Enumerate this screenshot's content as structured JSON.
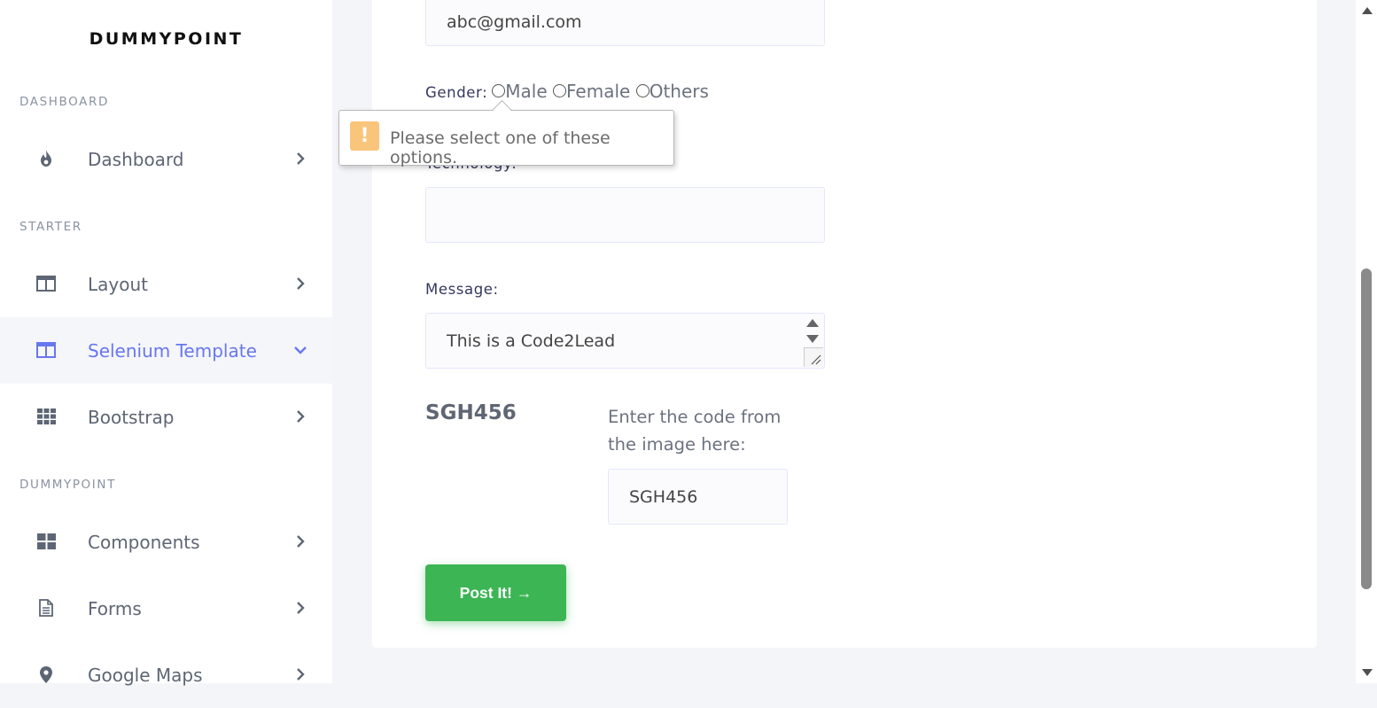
{
  "sidebar": {
    "brand": "DUMMYPOINT",
    "sections": [
      "DASHBOARD",
      "STARTER",
      "DUMMYPOINT"
    ],
    "items": [
      {
        "label": "Dashboard",
        "icon": "fire-icon"
      },
      {
        "label": "Layout",
        "icon": "columns-icon"
      },
      {
        "label": "Selenium Template",
        "icon": "columns-icon",
        "active": true
      },
      {
        "label": "Bootstrap",
        "icon": "grid-icon"
      },
      {
        "label": "Components",
        "icon": "th-large-icon"
      },
      {
        "label": "Forms",
        "icon": "file-icon"
      },
      {
        "label": "Google Maps",
        "icon": "map-marker-icon"
      }
    ]
  },
  "form": {
    "email_value": "abc@gmail.com",
    "gender_label": "Gender:",
    "gender_options": [
      "Male",
      "Female",
      "Others"
    ],
    "validation_tooltip": "Please select one of these options.",
    "technology_label": "Technology:",
    "technology_value": "",
    "message_label": "Message:",
    "message_value": "This is a Code2Lead",
    "captcha_code": "SGH456",
    "captcha_prompt": "Enter the code from the image here:",
    "captcha_value": "SGH456",
    "submit_label": "Post It! →"
  },
  "colors": {
    "accent": "#6777ef",
    "submit": "#3cb554",
    "warning": "#f9c57b"
  }
}
